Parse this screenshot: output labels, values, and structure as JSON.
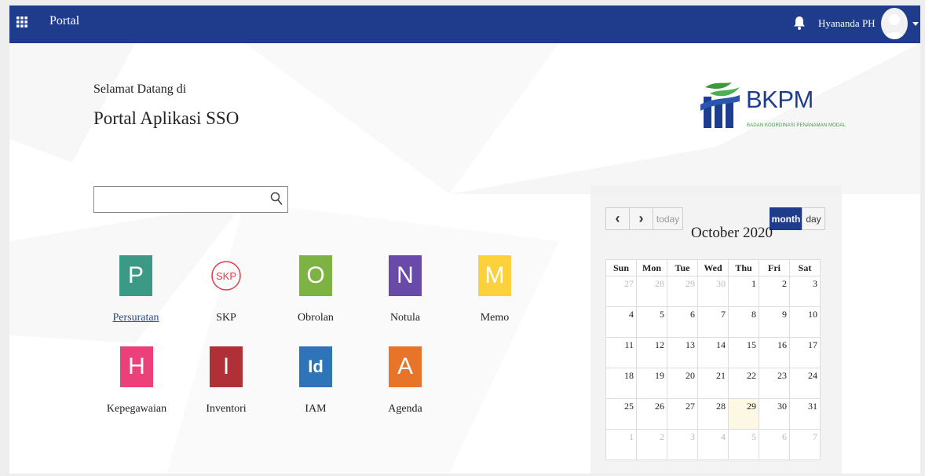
{
  "header": {
    "brand": "Portal",
    "username": "Hyananda PH"
  },
  "welcome": {
    "line1": "Selamat Datang di",
    "line2": "Portal Aplikasi SSO"
  },
  "logo": {
    "text": "BKPM",
    "subtitle": "BADAN KOORDINASI PENANAMAN MODAL"
  },
  "search": {
    "value": "",
    "placeholder": ""
  },
  "apps": [
    {
      "letter": "P",
      "label": "Persuratan",
      "color": "#3a9a86"
    },
    {
      "letter": "SKP",
      "label": "SKP",
      "color": "#e43a4a"
    },
    {
      "letter": "O",
      "label": "Obrolan",
      "color": "#7cb342"
    },
    {
      "letter": "N",
      "label": "Notula",
      "color": "#6a4aa8"
    },
    {
      "letter": "M",
      "label": "Memo",
      "color": "#fbd23c"
    },
    {
      "letter": "H",
      "label": "Kepegawaian",
      "color": "#ec407a"
    },
    {
      "letter": "I",
      "label": "Inventori",
      "color": "#b03038"
    },
    {
      "letter": "Id",
      "label": "IAM",
      "color": "#2e74b8"
    },
    {
      "letter": "A",
      "label": "Agenda",
      "color": "#e8742a"
    }
  ],
  "calendar": {
    "prev": "‹",
    "next": "›",
    "today": "today",
    "month": "month",
    "day": "day",
    "title": "October 2020",
    "weekdays": [
      "Sun",
      "Mon",
      "Tue",
      "Wed",
      "Thu",
      "Fri",
      "Sat"
    ],
    "weeks": [
      [
        "27",
        "28",
        "29",
        "30",
        "1",
        "2",
        "3"
      ],
      [
        "4",
        "5",
        "6",
        "7",
        "8",
        "9",
        "10"
      ],
      [
        "11",
        "12",
        "13",
        "14",
        "15",
        "16",
        "17"
      ],
      [
        "18",
        "19",
        "20",
        "21",
        "22",
        "23",
        "24"
      ],
      [
        "25",
        "26",
        "27",
        "28",
        "29",
        "30",
        "31"
      ],
      [
        "1",
        "2",
        "3",
        "4",
        "5",
        "6",
        "7"
      ]
    ],
    "today_date": "29",
    "accent": "#1f3c8c",
    "today_color": "#fcf8e3"
  },
  "colors": {
    "topbar": "#1f3c8c"
  }
}
